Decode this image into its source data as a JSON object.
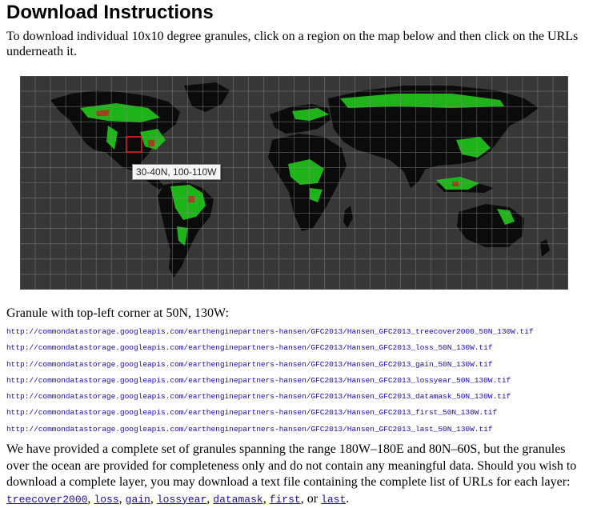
{
  "page": {
    "title": "Download Instructions",
    "intro": "To download individual 10x10 degree granules, click on a region on the map below and then click on the URLs underneath it."
  },
  "map": {
    "tooltip": "30-40N, 100-110W",
    "background_color": "#373737",
    "land_color": "#0b0b0b",
    "forest_color": "#22c61c",
    "loss_color": "#c81e1e",
    "selected_outline_color": "#ff2020"
  },
  "granule": {
    "heading": "Granule with top-left corner at 50N, 130W:",
    "urls": [
      "http://commondatastorage.googleapis.com/earthenginepartners-hansen/GFC2013/Hansen_GFC2013_treecover2000_50N_130W.tif",
      "http://commondatastorage.googleapis.com/earthenginepartners-hansen/GFC2013/Hansen_GFC2013_loss_50N_130W.tif",
      "http://commondatastorage.googleapis.com/earthenginepartners-hansen/GFC2013/Hansen_GFC2013_gain_50N_130W.tif",
      "http://commondatastorage.googleapis.com/earthenginepartners-hansen/GFC2013/Hansen_GFC2013_lossyear_50N_130W.tif",
      "http://commondatastorage.googleapis.com/earthenginepartners-hansen/GFC2013/Hansen_GFC2013_datamask_50N_130W.tif",
      "http://commondatastorage.googleapis.com/earthenginepartners-hansen/GFC2013/Hansen_GFC2013_first_50N_130W.tif",
      "http://commondatastorage.googleapis.com/earthenginepartners-hansen/GFC2013/Hansen_GFC2013_last_50N_130W.tif"
    ]
  },
  "summary": {
    "text": "We have provided a complete set of granules spanning the range 180W–180E and 80N–60S, but the granules over the ocean are provided for completeness only and do not contain any meaningful data. Should you wish to download a complete layer, you may download a text file containing the complete list of URLs for each layer: ",
    "links": [
      "treecover2000",
      "loss",
      "gain",
      "lossyear",
      "datamask",
      "first",
      "last"
    ],
    "or_text": "or",
    "end_text": "."
  }
}
